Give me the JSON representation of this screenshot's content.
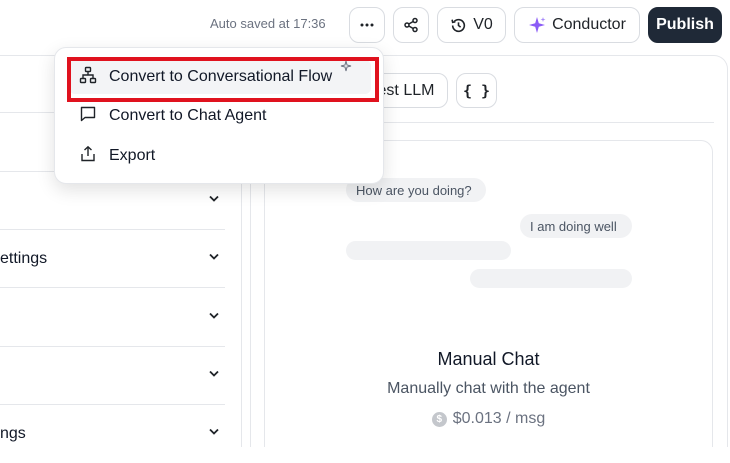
{
  "header": {
    "autosave_text": "Auto saved at 17:36",
    "version_label": "V0",
    "conductor_label": "Conductor",
    "publish_label": "Publish",
    "icons": {
      "more": "more-horizontal-icon",
      "share": "share-icon",
      "version": "history-icon",
      "conductor": "sparkle-icon"
    }
  },
  "dropdown_menu": {
    "items": [
      {
        "label": "Convert to Conversational Flow",
        "icon": "flow-tree-icon",
        "highlighted": true
      },
      {
        "label": "Convert to Chat Agent",
        "icon": "chat-bubble-icon"
      },
      {
        "label": "Export",
        "icon": "export-icon"
      }
    ]
  },
  "left_panel": {
    "rows": [
      {
        "label": ""
      },
      {
        "label": ""
      },
      {
        "label": ""
      },
      {
        "label": "ettings"
      },
      {
        "label": ""
      },
      {
        "label": ""
      },
      {
        "label": "ngs"
      }
    ]
  },
  "right_panel": {
    "test_llm_label": "est LLM",
    "json_label": "{ }",
    "chat_preview": {
      "question": "How are you doing?",
      "answer": "I am doing well"
    },
    "manual_chat": {
      "title": "Manual Chat",
      "subtitle": "Manually chat with the agent",
      "price": "$0.013 / msg",
      "coin_symbol": "$"
    }
  },
  "colors": {
    "accent_purple": "#8b5cf6",
    "publish_bg": "#1f2937",
    "highlight_red": "#e0121e"
  }
}
